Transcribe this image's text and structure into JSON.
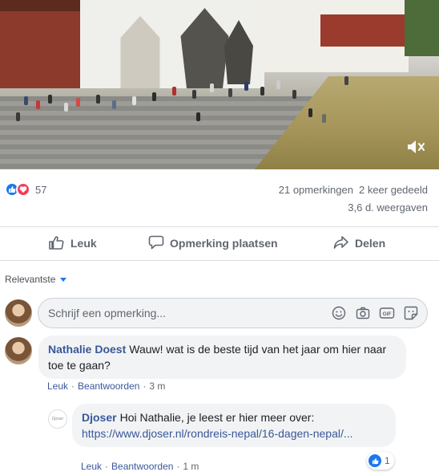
{
  "video": {
    "mute_icon": "speaker-muted-icon"
  },
  "stats": {
    "reaction_icons": [
      "like-reaction-icon",
      "love-reaction-icon"
    ],
    "reaction_count": "57",
    "comments": "21 opmerkingen",
    "shares": "2 keer gedeeld",
    "views": "3,6 d. weergaven"
  },
  "actions": {
    "like": "Leuk",
    "comment": "Opmerking plaatsen",
    "share": "Delen"
  },
  "filter": {
    "label": "Relevantste"
  },
  "composer": {
    "placeholder": "Schrijf een opmerking...",
    "icons": [
      "emoji-icon",
      "camera-icon",
      "gif-icon",
      "sticker-icon"
    ]
  },
  "comments": [
    {
      "author": "Nathalie Doest",
      "text": "Wauw! wat is de beste tijd van het jaar om hier naar toe te gaan?",
      "like": "Leuk",
      "reply": "Beantwoorden",
      "time": "3 m"
    },
    {
      "author": "Djoser",
      "avatar_text": "Djoser",
      "text": "Hoi Nathalie, je leest er hier meer over:",
      "link": "https://www.djoser.nl/rondreis-nepal/16-dagen-nepal/...",
      "like": "Leuk",
      "reply": "Beantwoorden",
      "time": "1 m",
      "like_count": "1"
    }
  ],
  "colors": {
    "accent": "#1877f2",
    "link": "#385898",
    "love": "#f33e58",
    "muted_text": "#606770"
  }
}
